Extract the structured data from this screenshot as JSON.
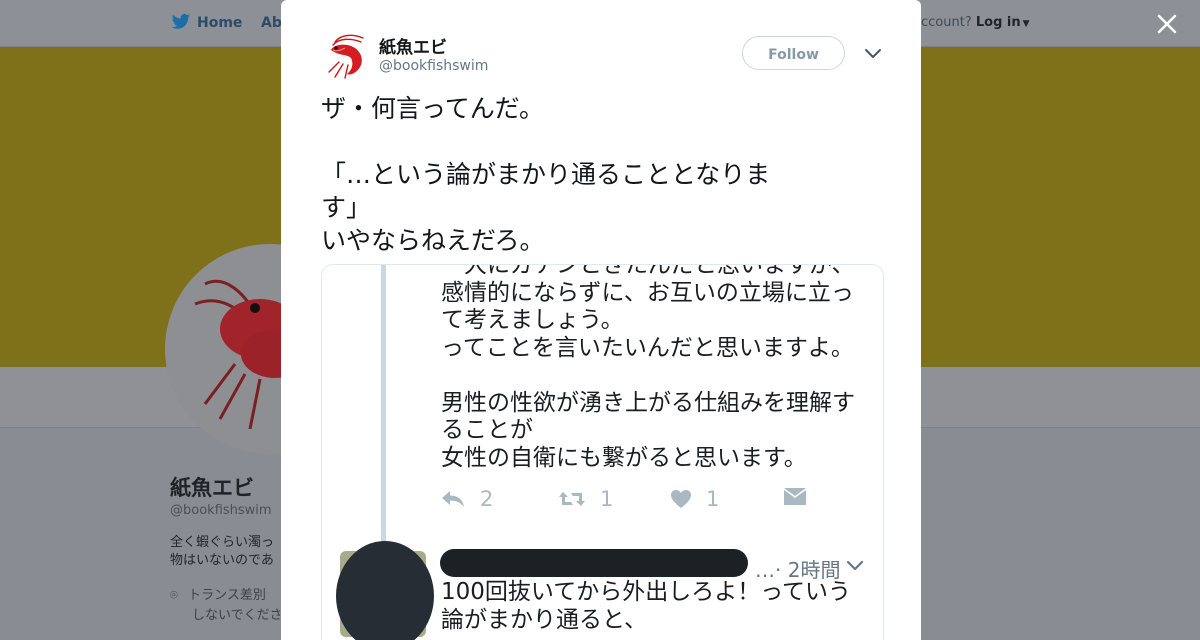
{
  "background": {
    "nav": {
      "home_label": "Home",
      "about_label": "Abo",
      "account_text": "ccount?",
      "login_label": "Log in"
    },
    "profile": {
      "name": "紙魚エビ",
      "handle": "@bookfishswim",
      "bio_line1": "全く蝦ぐらい濁っ",
      "bio_line2": "物はいないのであ",
      "location_line1": "トランス差別",
      "location_line2": "しないでくださ"
    },
    "banner_color": "#7e7119"
  },
  "modal": {
    "author": {
      "name": "紙魚エビ",
      "handle": "@bookfishswim"
    },
    "follow_label": "Follow",
    "tweet_lines": [
      "ザ・何言ってんだ。",
      "",
      "「…という論がまかり通ることとなりま",
      "す」",
      "いやならねえだろ。"
    ],
    "embedded": {
      "top_lines": [
        "一大にガチンときたんだと思いますが、",
        "感情的にならずに、お互いの立場に立っ",
        "て考えましょう。",
        "ってことを言いたいんだと思いますよ。",
        "",
        "男性の性欲が湧き上がる仕組みを理解す",
        "ることが",
        "女性の自衛にも繋がると思います。"
      ],
      "reply_count": "2",
      "retweet_count": "1",
      "like_count": "1",
      "reply_time": "…· 2時間",
      "reply_lines": [
        "100回抜いてから外出しろよ！っていう",
        "論がまかり通ると、"
      ]
    }
  },
  "colors": {
    "accent": "#1da1f2",
    "icon_gray": "#aab8c2"
  }
}
